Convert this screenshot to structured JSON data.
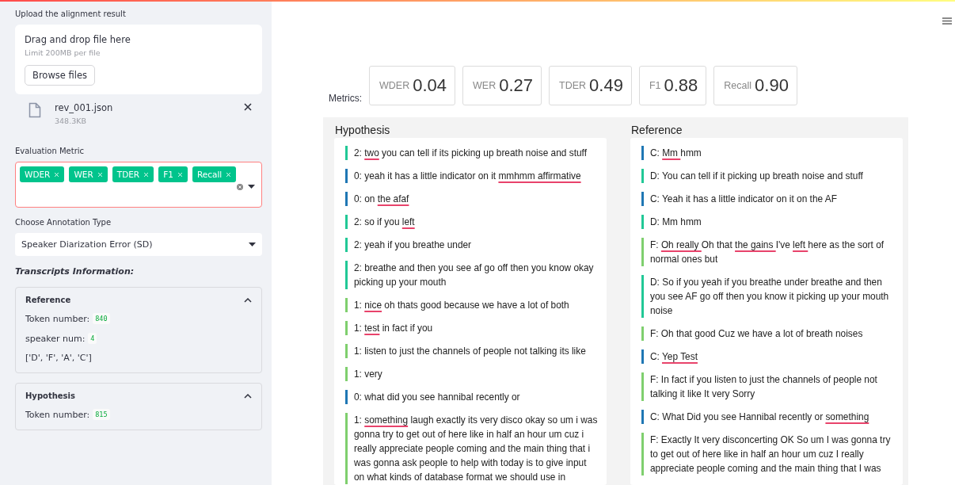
{
  "sidebar": {
    "upload": {
      "label": "Upload the alignment result",
      "drop_title": "Drag and drop file here",
      "limit": "Limit 200MB per file",
      "browse_button": "Browse files",
      "file": {
        "name": "rev_001.json",
        "size": "348.3KB"
      }
    },
    "metric_select": {
      "label": "Evaluation Metric",
      "tags": [
        "WDER",
        "WER",
        "TDER",
        "F1",
        "Recall"
      ]
    },
    "annotation_select": {
      "label": "Choose Annotation Type",
      "value": "Speaker Diarization Error (SD)"
    },
    "info_heading": "Transcripts Information:",
    "expanders": [
      {
        "title": "Reference",
        "expanded": true,
        "rows": [
          {
            "label": "Token number:",
            "code": "840"
          },
          {
            "label": "speaker num:",
            "code": "4"
          },
          {
            "text": "['D', 'F', 'A', 'C']"
          }
        ]
      },
      {
        "title": "Hypothesis",
        "expanded": true,
        "rows": [
          {
            "label": "Token number:",
            "code": "815"
          }
        ]
      }
    ]
  },
  "main": {
    "metrics_label": "Metrics:",
    "metrics": [
      {
        "name": "WDER",
        "value": "0.04"
      },
      {
        "name": "WER",
        "value": "0.27"
      },
      {
        "name": "TDER",
        "value": "0.49"
      },
      {
        "name": "F1",
        "value": "0.88"
      },
      {
        "name": "Recall",
        "value": "0.90"
      }
    ],
    "transcripts": [
      {
        "title": "Hypothesis",
        "utterances": [
          {
            "color": "#21c896",
            "segments": [
              {
                "text": "2: ",
                "error": false
              },
              {
                "text": "two",
                "error": true
              },
              {
                "text": " you can tell if its picking up breath noise and stuff",
                "error": false
              }
            ]
          },
          {
            "color": "#1f77b4",
            "segments": [
              {
                "text": "0: yeah it has a little indicator on it ",
                "error": false
              },
              {
                "text": "mmhmm affirmative",
                "error": true
              }
            ]
          },
          {
            "color": "#1f77b4",
            "segments": [
              {
                "text": "0: on ",
                "error": false
              },
              {
                "text": "the afaf",
                "error": true
              }
            ]
          },
          {
            "color": "#21c896",
            "segments": [
              {
                "text": "2: so if you ",
                "error": false
              },
              {
                "text": "left",
                "error": true
              }
            ]
          },
          {
            "color": "#21c896",
            "segments": [
              {
                "text": "2: yeah if you breathe under",
                "error": false
              }
            ]
          },
          {
            "color": "#21c896",
            "segments": [
              {
                "text": "2: breathe and then you see af go off then you know okay picking up your mouth",
                "error": false
              }
            ]
          },
          {
            "color": "#7fcf6e",
            "segments": [
              {
                "text": "1: ",
                "error": false
              },
              {
                "text": "nice",
                "error": true
              },
              {
                "text": " oh thats good because we have a lot of both",
                "error": false
              }
            ]
          },
          {
            "color": "#7fcf6e",
            "segments": [
              {
                "text": "1: ",
                "error": false
              },
              {
                "text": "test",
                "error": true
              },
              {
                "text": " in fact if you",
                "error": false
              }
            ]
          },
          {
            "color": "#7fcf6e",
            "segments": [
              {
                "text": "1: listen to just the channels of people not talking its like",
                "error": false
              }
            ]
          },
          {
            "color": "#7fcf6e",
            "segments": [
              {
                "text": "1: very",
                "error": false
              }
            ]
          },
          {
            "color": "#1f77b4",
            "segments": [
              {
                "text": "0: what did you see hannibal recently or",
                "error": false
              }
            ]
          },
          {
            "color": "#7fcf6e",
            "segments": [
              {
                "text": "1: ",
                "error": false
              },
              {
                "text": "something",
                "error": true
              },
              {
                "text": " laugh exactly its very disco okay so um i was gonna try to get out of here like in half an hour um cuz i really appreciate people coming and the main thing that i was gonna ask people to help with today is to give input on what kinds of database format we should use in",
                "error": false
              }
            ]
          }
        ]
      },
      {
        "title": "Reference",
        "utterances": [
          {
            "color": "#1f77b4",
            "segments": [
              {
                "text": "C: ",
                "error": false
              },
              {
                "text": "Mm ",
                "error": true
              },
              {
                "text": "hmm",
                "error": false
              }
            ]
          },
          {
            "color": "#21c896",
            "segments": [
              {
                "text": "D: You can tell if it picking up breath noise and stuff",
                "error": false
              }
            ]
          },
          {
            "color": "#1f77b4",
            "segments": [
              {
                "text": "C: Yeah it has a little indicator on it on the AF",
                "error": false
              }
            ]
          },
          {
            "color": "#21c896",
            "segments": [
              {
                "text": "D: Mm hmm",
                "error": false
              }
            ]
          },
          {
            "color": "#7fcf6e",
            "segments": [
              {
                "text": "F: ",
                "error": false
              },
              {
                "text": "Oh really ",
                "error": true
              },
              {
                "text": "Oh that ",
                "error": false
              },
              {
                "text": "the gains ",
                "error": true
              },
              {
                "text": "I've ",
                "error": false
              },
              {
                "text": "left ",
                "error": true
              },
              {
                "text": "here as the sort of normal ones but",
                "error": false
              }
            ]
          },
          {
            "color": "#21c896",
            "segments": [
              {
                "text": "D: So if you yeah if you breathe under breathe and then you see AF go off then you know it picking up your mouth noise",
                "error": false
              }
            ]
          },
          {
            "color": "#7fcf6e",
            "segments": [
              {
                "text": "F: Oh that good Cuz we have a lot of breath noises",
                "error": false
              }
            ]
          },
          {
            "color": "#1f77b4",
            "segments": [
              {
                "text": "C: ",
                "error": false
              },
              {
                "text": "Yep Test",
                "error": true
              }
            ]
          },
          {
            "color": "#7fcf6e",
            "segments": [
              {
                "text": "F: In fact if you listen to just the channels of people not talking it like It very Sorry",
                "error": false
              }
            ]
          },
          {
            "color": "#1f77b4",
            "segments": [
              {
                "text": "C: What Did you see Hannibal recently or ",
                "error": false
              },
              {
                "text": "something",
                "error": true
              }
            ]
          },
          {
            "color": "#7fcf6e",
            "segments": [
              {
                "text": "F: Exactly It very disconcerting OK So um I was gonna try to get out of here like in half an hour um cuz I really appreciate people coming and the main thing that I was",
                "error": false
              }
            ]
          }
        ]
      }
    ]
  }
}
